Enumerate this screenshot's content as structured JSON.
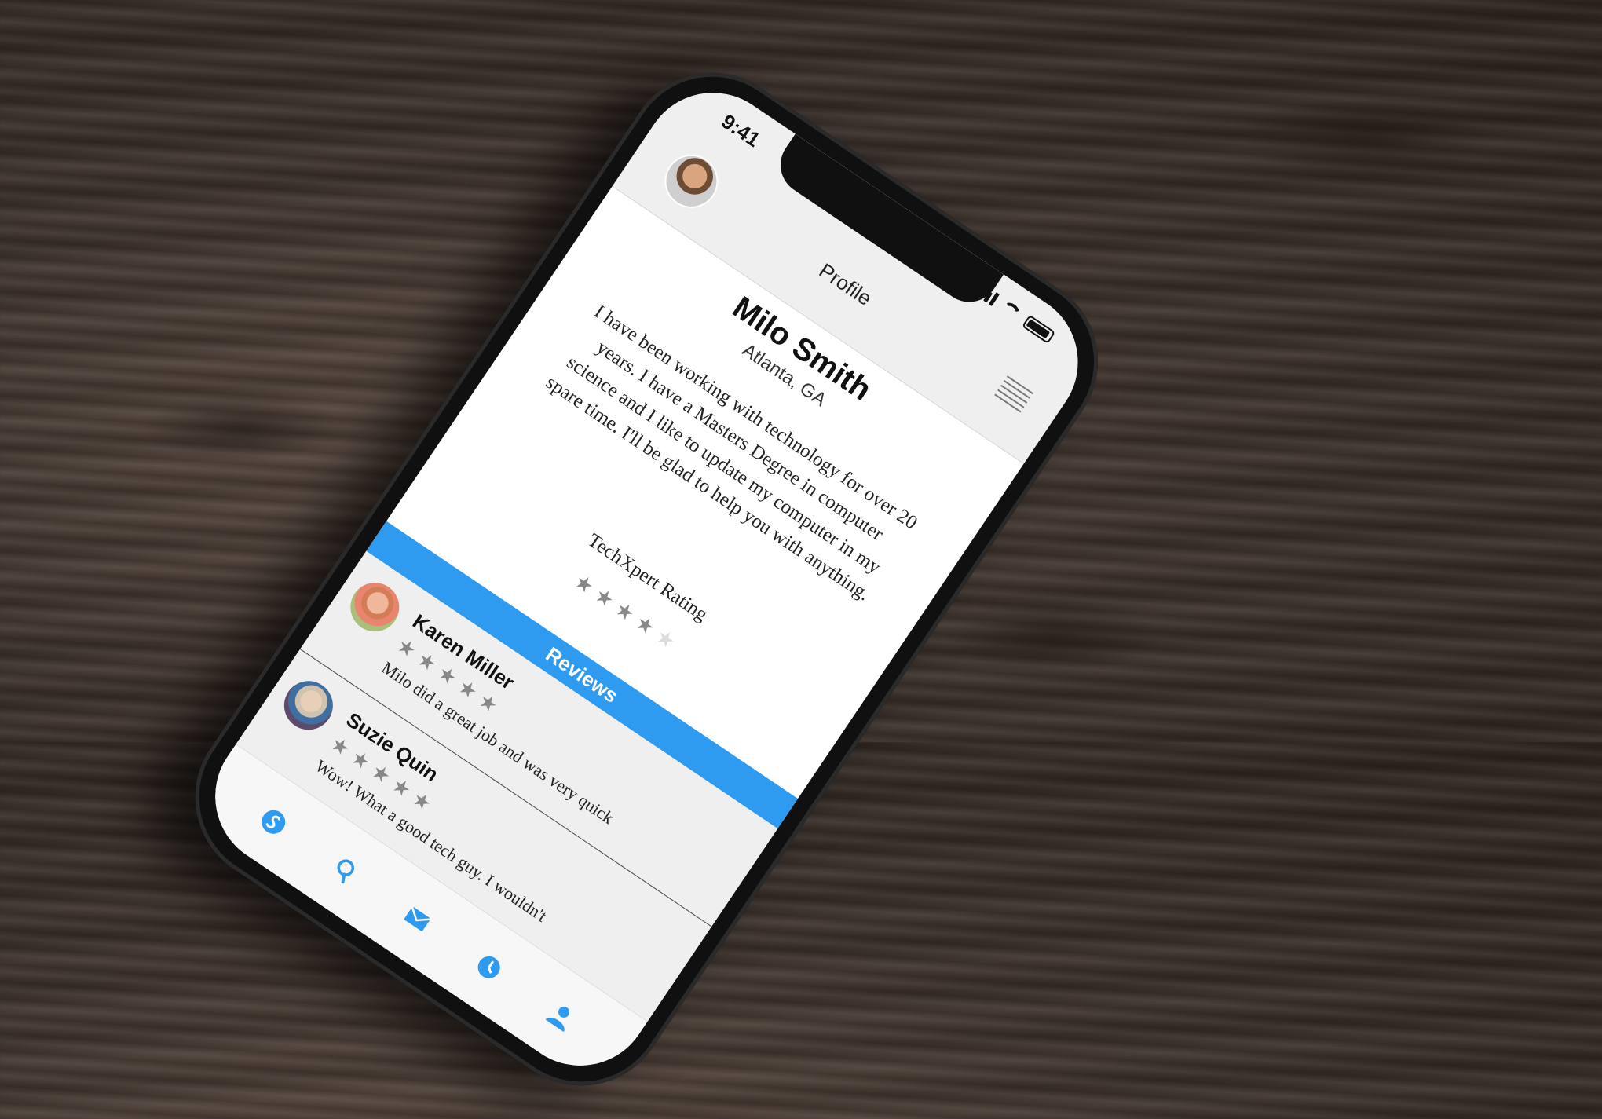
{
  "status_bar": {
    "time": "9:41"
  },
  "nav": {
    "title": "Profile"
  },
  "profile": {
    "name": "Milo Smith",
    "location": "Atlanta, GA",
    "bio": "I have been working with technology for over 20 years. I have a Masters Degree in computer science and I like to update my computer in my spare time. I'll be glad to help you with anything."
  },
  "rating": {
    "label": "TechXpert Rating",
    "value": 4,
    "max": 5
  },
  "reviews": {
    "header": "Reviews",
    "items": [
      {
        "name": "Karen Miller",
        "stars": 5,
        "text": "Milo did a great job and was very quick"
      },
      {
        "name": "Suzie Quin",
        "stars": 5,
        "text": "Wow! What a good tech guy. I wouldn't"
      }
    ]
  },
  "tabs": [
    "home-icon",
    "search-icon",
    "mail-icon",
    "clock-icon",
    "user-icon"
  ],
  "colors": {
    "accent": "#2f9bf0",
    "star": "#888888",
    "star_empty": "#dcdcdc"
  }
}
